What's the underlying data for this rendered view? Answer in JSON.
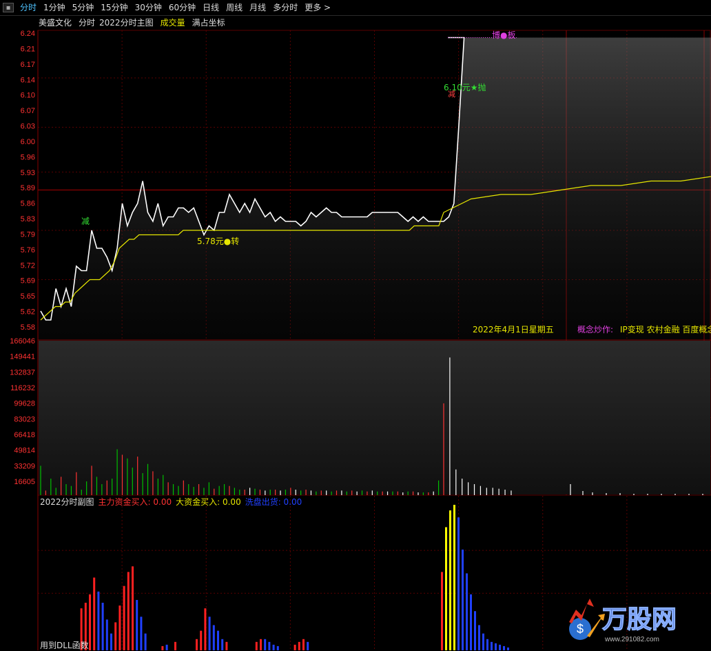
{
  "tabs": [
    {
      "label": "分时",
      "active": true
    },
    {
      "label": "1分钟"
    },
    {
      "label": "5分钟"
    },
    {
      "label": "15分钟"
    },
    {
      "label": "30分钟"
    },
    {
      "label": "60分钟"
    },
    {
      "label": "日线"
    },
    {
      "label": "周线"
    },
    {
      "label": "月线"
    },
    {
      "label": "多分时"
    },
    {
      "label": "更多 >"
    }
  ],
  "header": {
    "stock_name": "美盛文化",
    "mode": "分时",
    "template": "2022分时主图",
    "volume_label": "成交量",
    "axis_mode": "满占坐标"
  },
  "price_axis": [
    "6.24",
    "6.21",
    "6.17",
    "6.14",
    "6.10",
    "6.07",
    "6.03",
    "6.00",
    "5.96",
    "5.93",
    "5.89",
    "5.86",
    "5.83",
    "5.79",
    "5.76",
    "5.72",
    "5.69",
    "5.65",
    "5.62",
    "5.58"
  ],
  "volume_axis": [
    "166046",
    "149441",
    "132837",
    "116232",
    "99628",
    "83023",
    "66418",
    "49814",
    "33209",
    "16605"
  ],
  "annotations": {
    "reduce_1": "减",
    "turn": "5.78元●转",
    "sell": "6.10元★抛",
    "reduce_2": "减",
    "limit": "博●板",
    "date": "2022年4月1日星期五",
    "concept_label": "概念炒作:",
    "concepts": "IP变现 农村金融 百度概念"
  },
  "sub_chart": {
    "title": "2022分时副图",
    "main_buy": "主力资金买入: 0.00",
    "large_buy": "大资金买入: 0.00",
    "wash": "洗盘出货: 0.00"
  },
  "footer": "用到DLL函数",
  "logo": {
    "text": "万股网",
    "url": "www.291082.com"
  },
  "colors": {
    "up": "#ff3232",
    "down": "#00c000",
    "price": "#ffffff",
    "avg": "#e6e600",
    "grid": "#5a0000",
    "axis_text": "#ff3232",
    "concept": "#e040e0",
    "yellow": "#ffff00",
    "blue": "#2040ff"
  },
  "chart_data": {
    "type": "line",
    "price_range": [
      5.58,
      6.24
    ],
    "prev_close": 5.89,
    "price_series": [
      5.62,
      5.6,
      5.6,
      5.67,
      5.63,
      5.67,
      5.63,
      5.72,
      5.71,
      5.71,
      5.8,
      5.76,
      5.76,
      5.74,
      5.71,
      5.76,
      5.86,
      5.81,
      5.84,
      5.86,
      5.91,
      5.84,
      5.82,
      5.86,
      5.81,
      5.83,
      5.83,
      5.85,
      5.85,
      5.84,
      5.85,
      5.82,
      5.79,
      5.81,
      5.8,
      5.84,
      5.84,
      5.88,
      5.86,
      5.84,
      5.86,
      5.84,
      5.87,
      5.85,
      5.83,
      5.84,
      5.82,
      5.83,
      5.82,
      5.82,
      5.82,
      5.81,
      5.82,
      5.84,
      5.83,
      5.84,
      5.85,
      5.84,
      5.84,
      5.83,
      5.83,
      5.83,
      5.83,
      5.83,
      5.83,
      5.84,
      5.84,
      5.84,
      5.84,
      5.84,
      5.84,
      5.83,
      5.82,
      5.83,
      5.82,
      5.83,
      5.82,
      5.82,
      5.82,
      5.82,
      5.83,
      5.86,
      6.04,
      6.23
    ],
    "avg_series": [
      5.6,
      5.61,
      5.62,
      5.63,
      5.63,
      5.64,
      5.64,
      5.66,
      5.67,
      5.68,
      5.69,
      5.69,
      5.69,
      5.7,
      5.71,
      5.73,
      5.76,
      5.77,
      5.78,
      5.78,
      5.79,
      5.79,
      5.79,
      5.79,
      5.79,
      5.79,
      5.79,
      5.79,
      5.79,
      5.8,
      5.8,
      5.8,
      5.8,
      5.8,
      5.8,
      5.8,
      5.8,
      5.8,
      5.8,
      5.8,
      5.8,
      5.8,
      5.8,
      5.8,
      5.8,
      5.8,
      5.8,
      5.8,
      5.8,
      5.8,
      5.8,
      5.8,
      5.8,
      5.8,
      5.8,
      5.8,
      5.8,
      5.8,
      5.8,
      5.8,
      5.8,
      5.8,
      5.8,
      5.8,
      5.8,
      5.8,
      5.8,
      5.8,
      5.8,
      5.8,
      5.8,
      5.8,
      5.8,
      5.8,
      5.8,
      5.8,
      5.81,
      5.81,
      5.81,
      5.81,
      5.81,
      5.81,
      5.84,
      5.87,
      5.88,
      5.88,
      5.89,
      5.9,
      5.9,
      5.91,
      5.91,
      5.92
    ],
    "volume_max": 166046,
    "volumes": [
      [
        1,
        32000
      ],
      [
        2,
        5000
      ],
      [
        3,
        18000
      ],
      [
        4,
        8000
      ],
      [
        5,
        20000
      ],
      [
        6,
        12000
      ],
      [
        7,
        10000
      ],
      [
        8,
        25000
      ],
      [
        9,
        6000
      ],
      [
        10,
        15000
      ],
      [
        11,
        32000
      ],
      [
        12,
        20000
      ],
      [
        13,
        12000
      ],
      [
        14,
        16000
      ],
      [
        15,
        18000
      ],
      [
        16,
        50000
      ],
      [
        17,
        44000
      ],
      [
        18,
        40000
      ],
      [
        19,
        30000
      ],
      [
        20,
        42000
      ],
      [
        21,
        24000
      ],
      [
        22,
        34000
      ],
      [
        23,
        26000
      ],
      [
        24,
        18000
      ],
      [
        25,
        22000
      ],
      [
        26,
        14000
      ],
      [
        27,
        12000
      ],
      [
        28,
        10000
      ],
      [
        29,
        16000
      ],
      [
        30,
        12000
      ],
      [
        31,
        9000
      ],
      [
        32,
        12000
      ],
      [
        33,
        8000
      ],
      [
        34,
        14000
      ],
      [
        35,
        7000
      ],
      [
        36,
        10000
      ],
      [
        37,
        12000
      ],
      [
        38,
        10000
      ],
      [
        39,
        8000
      ],
      [
        40,
        6000
      ],
      [
        41,
        6000
      ],
      [
        42,
        8000
      ],
      [
        43,
        7000
      ],
      [
        44,
        6000
      ],
      [
        45,
        5000
      ],
      [
        46,
        6000
      ],
      [
        47,
        6000
      ],
      [
        48,
        5000
      ],
      [
        49,
        6000
      ],
      [
        50,
        8000
      ],
      [
        51,
        6000
      ],
      [
        52,
        5000
      ],
      [
        53,
        6000
      ],
      [
        54,
        5000
      ],
      [
        55,
        4000
      ],
      [
        56,
        5000
      ],
      [
        57,
        5000
      ],
      [
        58,
        4000
      ],
      [
        59,
        5000
      ],
      [
        60,
        5000
      ],
      [
        61,
        4000
      ],
      [
        62,
        5000
      ],
      [
        63,
        4000
      ],
      [
        64,
        5000
      ],
      [
        65,
        4000
      ],
      [
        66,
        5000
      ],
      [
        67,
        4000
      ],
      [
        68,
        4000
      ],
      [
        69,
        4000
      ],
      [
        70,
        4000
      ],
      [
        71,
        4000
      ],
      [
        72,
        3000
      ],
      [
        73,
        4000
      ],
      [
        74,
        4000
      ],
      [
        75,
        3000
      ],
      [
        76,
        3000
      ],
      [
        77,
        3000
      ],
      [
        78,
        4000
      ],
      [
        79,
        16000
      ],
      [
        80,
        100000
      ],
      [
        81,
        150000
      ],
      [
        82,
        28000
      ],
      [
        83,
        18000
      ],
      [
        84,
        14000
      ],
      [
        85,
        12000
      ],
      [
        86,
        10000
      ],
      [
        87,
        8000
      ],
      [
        88,
        8000
      ],
      [
        89,
        7000
      ],
      [
        90,
        6000
      ],
      [
        91,
        5000
      ]
    ],
    "sub_bars": [
      [
        3,
        0.3,
        "r"
      ],
      [
        4,
        0.34,
        "r"
      ],
      [
        5,
        0.4,
        "r"
      ],
      [
        6,
        0.52,
        "r"
      ],
      [
        7,
        0.42,
        "b"
      ],
      [
        8,
        0.34,
        "b"
      ],
      [
        9,
        0.22,
        "b"
      ],
      [
        10,
        0.12,
        "b"
      ],
      [
        11,
        0.2,
        "r"
      ],
      [
        12,
        0.32,
        "r"
      ],
      [
        13,
        0.46,
        "r"
      ],
      [
        14,
        0.56,
        "r"
      ],
      [
        15,
        0.6,
        "r"
      ],
      [
        16,
        0.36,
        "b"
      ],
      [
        17,
        0.24,
        "b"
      ],
      [
        18,
        0.12,
        "b"
      ],
      [
        22,
        0.03,
        "r"
      ],
      [
        23,
        0.04,
        "b"
      ],
      [
        25,
        0.06,
        "r"
      ],
      [
        30,
        0.08,
        "r"
      ],
      [
        31,
        0.14,
        "r"
      ],
      [
        32,
        0.3,
        "r"
      ],
      [
        33,
        0.24,
        "b"
      ],
      [
        34,
        0.18,
        "b"
      ],
      [
        35,
        0.14,
        "b"
      ],
      [
        36,
        0.08,
        "b"
      ],
      [
        37,
        0.06,
        "r"
      ],
      [
        44,
        0.06,
        "r"
      ],
      [
        45,
        0.08,
        "r"
      ],
      [
        46,
        0.08,
        "b"
      ],
      [
        47,
        0.06,
        "b"
      ],
      [
        48,
        0.04,
        "b"
      ],
      [
        49,
        0.03,
        "b"
      ],
      [
        53,
        0.04,
        "r"
      ],
      [
        54,
        0.06,
        "r"
      ],
      [
        55,
        0.08,
        "r"
      ],
      [
        56,
        0.06,
        "b"
      ],
      [
        64,
        0.56,
        "r"
      ],
      [
        65,
        0.88,
        "y"
      ],
      [
        66,
        1.0,
        "y"
      ],
      [
        67,
        1.04,
        "y"
      ],
      [
        68,
        0.95,
        "b"
      ],
      [
        69,
        0.72,
        "b"
      ],
      [
        70,
        0.55,
        "b"
      ],
      [
        71,
        0.4,
        "b"
      ],
      [
        72,
        0.28,
        "b"
      ],
      [
        73,
        0.18,
        "b"
      ],
      [
        74,
        0.12,
        "b"
      ],
      [
        75,
        0.08,
        "b"
      ],
      [
        76,
        0.06,
        "b"
      ],
      [
        77,
        0.05,
        "b"
      ],
      [
        78,
        0.04,
        "b"
      ],
      [
        79,
        0.03,
        "b"
      ],
      [
        80,
        0.02,
        "b"
      ]
    ]
  }
}
